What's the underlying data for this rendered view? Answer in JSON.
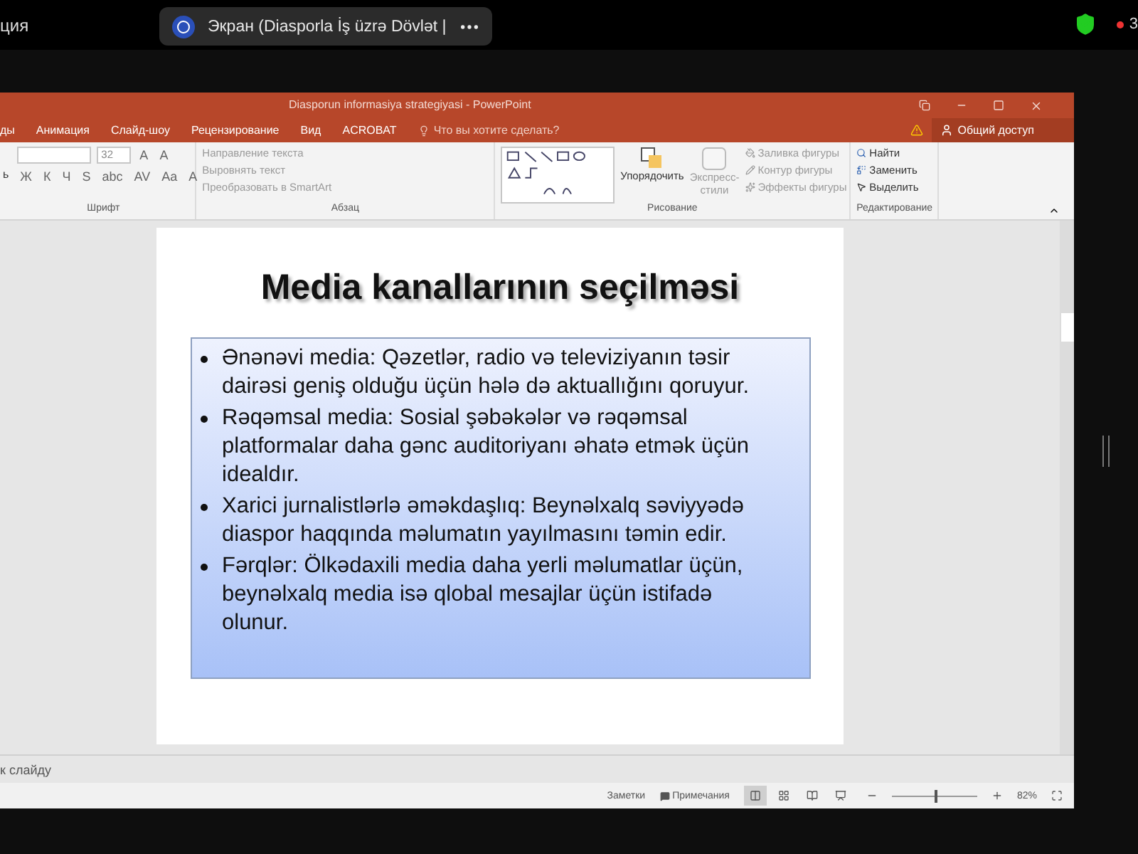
{
  "meeting_bar": {
    "left_text": "ция",
    "share_label": "Экран (Diasporla İş üzrə Dövlət |",
    "recording_text": "3"
  },
  "window": {
    "title": "Diasporun informasiya strategiyasi - PowerPoint"
  },
  "tabs": [
    {
      "label": "ды",
      "selected": false
    },
    {
      "label": "Анимация",
      "selected": false
    },
    {
      "label": "Слайд-шоу",
      "selected": false
    },
    {
      "label": "Рецензирование",
      "selected": false
    },
    {
      "label": "Вид",
      "selected": false
    },
    {
      "label": "ACROBAT",
      "selected": false
    }
  ],
  "tell_me": {
    "placeholder": "Что вы хотите сделать?"
  },
  "share_button": "Общий доступ",
  "ribbon": {
    "clipboard_fragment": "ь",
    "font": {
      "size": "32",
      "grow": "A",
      "shrink": "A",
      "buttons": [
        "Ж",
        "К",
        "Ч",
        "S",
        "abc",
        "AV",
        "Aa",
        "A"
      ],
      "label": "Шрифт"
    },
    "paragraph": {
      "commands": [
        {
          "label": "Направление текста",
          "disabled": true
        },
        {
          "label": "Выровнять текст",
          "disabled": true
        },
        {
          "label": "Преобразовать в SmartArt",
          "disabled": true
        }
      ],
      "label": "Абзац"
    },
    "drawing": {
      "arrange": "Упорядочить",
      "styles": {
        "label": "Экспресс-стили",
        "disabled": true
      },
      "commands": [
        {
          "label": "Заливка фигуры",
          "disabled": true
        },
        {
          "label": "Контур фигуры",
          "disabled": true
        },
        {
          "label": "Эффекты фигуры",
          "disabled": true
        }
      ],
      "label": "Рисование"
    },
    "editing": {
      "commands": [
        {
          "label": "Найти",
          "disabled": false
        },
        {
          "label": "Заменить",
          "disabled": false
        },
        {
          "label": "Выделить",
          "disabled": false
        }
      ],
      "label": "Редактирование"
    }
  },
  "slide": {
    "title": "Media kanallarının seçilməsi",
    "bullets": [
      "Ənənəvi media: Qəzetlər, radio və televiziyanın təsir dairəsi geniş olduğu üçün hələ də aktuallığını qoruyur.",
      "Rəqəmsal media: Sosial şəbəkələr və rəqəmsal platformalar daha gənc auditoriyanı əhatə etmək üçün idealdır.",
      "Xarici jurnalistlərlə əməkdaşlıq: Beynəlxalq səviyyədə diaspor haqqında məlumatın yayılmasını təmin edir.",
      "Fərqlər: Ölkədaxili media daha yerli məlumatlar üçün, beynəlxalq media isə qlobal mesajlar üçün istifadə olunur."
    ]
  },
  "notes": {
    "placeholder": "к слайду"
  },
  "status_bar": {
    "notes": "Заметки",
    "comments": "Примечания",
    "views": [
      {
        "kind": "normal",
        "selected": true
      },
      {
        "kind": "sorter",
        "selected": false
      },
      {
        "kind": "reading",
        "selected": false
      },
      {
        "kind": "show",
        "selected": false
      }
    ],
    "zoom": {
      "level": 0.5,
      "reading": "82%"
    }
  }
}
